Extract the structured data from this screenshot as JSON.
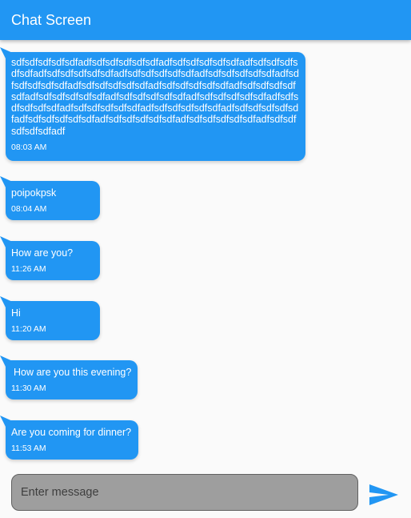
{
  "appbar": {
    "title": "Chat Screen"
  },
  "messages": [
    {
      "text": "sdfsdfsdfsdfsdfadfsdfsdfsdfsdfsdfadfsdfsdfsdfsdfsdfadfsdfsdfsdfsdfsdfadfsdfsdfsdfsdfsdfadfsdfsdfsdfsdfsdfadfsdfsdfsdfsdfsdfadfsdfsdfsdfsdfsdfadfsdfsdfsdfsdfsdfadfsdfsdfsdfsdfsdfadfsdfsdfsdfsdfsdfadfsdfsdfsdfsdfsdfadfsdfsdfsdfsdfsdfadfsdfsdfsdfsdfsdfadfsdfsdfsdfsdfsdfadfsdfsdfsdfsdfsdfadfsdfsdfsdfsdfsdfadfsdfsdfsdfsdfsdfadfsdfsdfsdfsdfsdfadfsdfsdfsdfsdfsdfadfsdfsdfsdfsdfsdfadfsdfsdfsdfsdfsdfadf",
      "time": "08:03 AM"
    },
    {
      "text": "poipokpsk",
      "time": "08:04 AM"
    },
    {
      "text": "How are you?",
      "time": "11:26 AM"
    },
    {
      "text": "Hi",
      "time": "11:20 AM"
    },
    {
      "text": "How are you this evening?",
      "time": "11:30 AM"
    },
    {
      "text": "Are you coming for dinner?",
      "time": "11:53 AM"
    }
  ],
  "composer": {
    "placeholder": "Enter message",
    "value": "",
    "send_icon": "send-icon"
  },
  "colors": {
    "primary": "#2196f3",
    "background": "#fafafa",
    "input_fill": "#9e9e9e",
    "input_border": "#616161",
    "text_on_primary": "#ffffff"
  }
}
